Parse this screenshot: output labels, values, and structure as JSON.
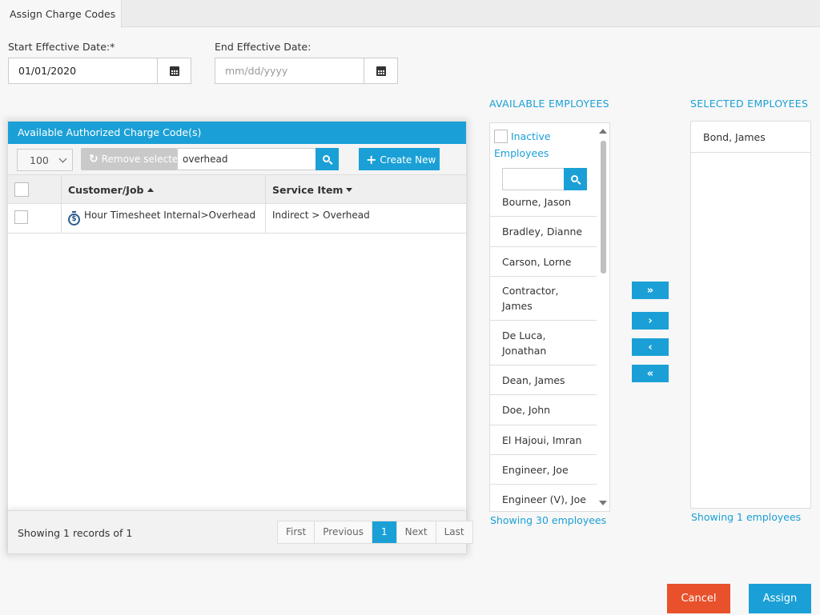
{
  "tab": {
    "title": "Assign Charge Codes"
  },
  "dates": {
    "start_label": "Start Effective Date:*",
    "start_value": "01/01/2020",
    "end_label": "End Effective Date:",
    "end_placeholder": "mm/dd/yyyy"
  },
  "charge_codes": {
    "title": "Available Authorized Charge Code(s)",
    "page_size": "100",
    "remove_label": "Remove selected",
    "search_value": "overhead",
    "create_label": "Create New",
    "columns": [
      "Customer/Job",
      "Service Item"
    ],
    "rows": [
      {
        "customer_job": "Hour Timesheet Internal>Overhead",
        "service_item": "Indirect > Overhead"
      }
    ],
    "showing": "Showing 1 records of 1",
    "pager": [
      "First",
      "Previous",
      "1",
      "Next",
      "Last"
    ],
    "current_page": "1"
  },
  "available": {
    "title": "AVAILABLE EMPLOYEES",
    "inactive_label": "Inactive Employees",
    "search_placeholder": "",
    "employees": [
      "Bourne, Jason",
      "Bradley, Dianne",
      "Carson, Lorne",
      "Contractor, James",
      "De Luca, Jonathan",
      "Dean, James",
      "Doe, John",
      "El Hajoui, Imran",
      "Engineer, Joe",
      "Engineer (V), Joe"
    ],
    "count_text": "Showing 30 employees"
  },
  "move_buttons": [
    "»",
    "›",
    "‹",
    "«"
  ],
  "selected": {
    "title": "SELECTED EMPLOYEES",
    "employees": [
      "Bond, James"
    ],
    "count_text": "Showing 1 employees"
  },
  "actions": {
    "cancel": "Cancel",
    "assign": "Assign"
  },
  "colors": {
    "accent": "#1aa0d6",
    "cancel": "#e8512b"
  }
}
